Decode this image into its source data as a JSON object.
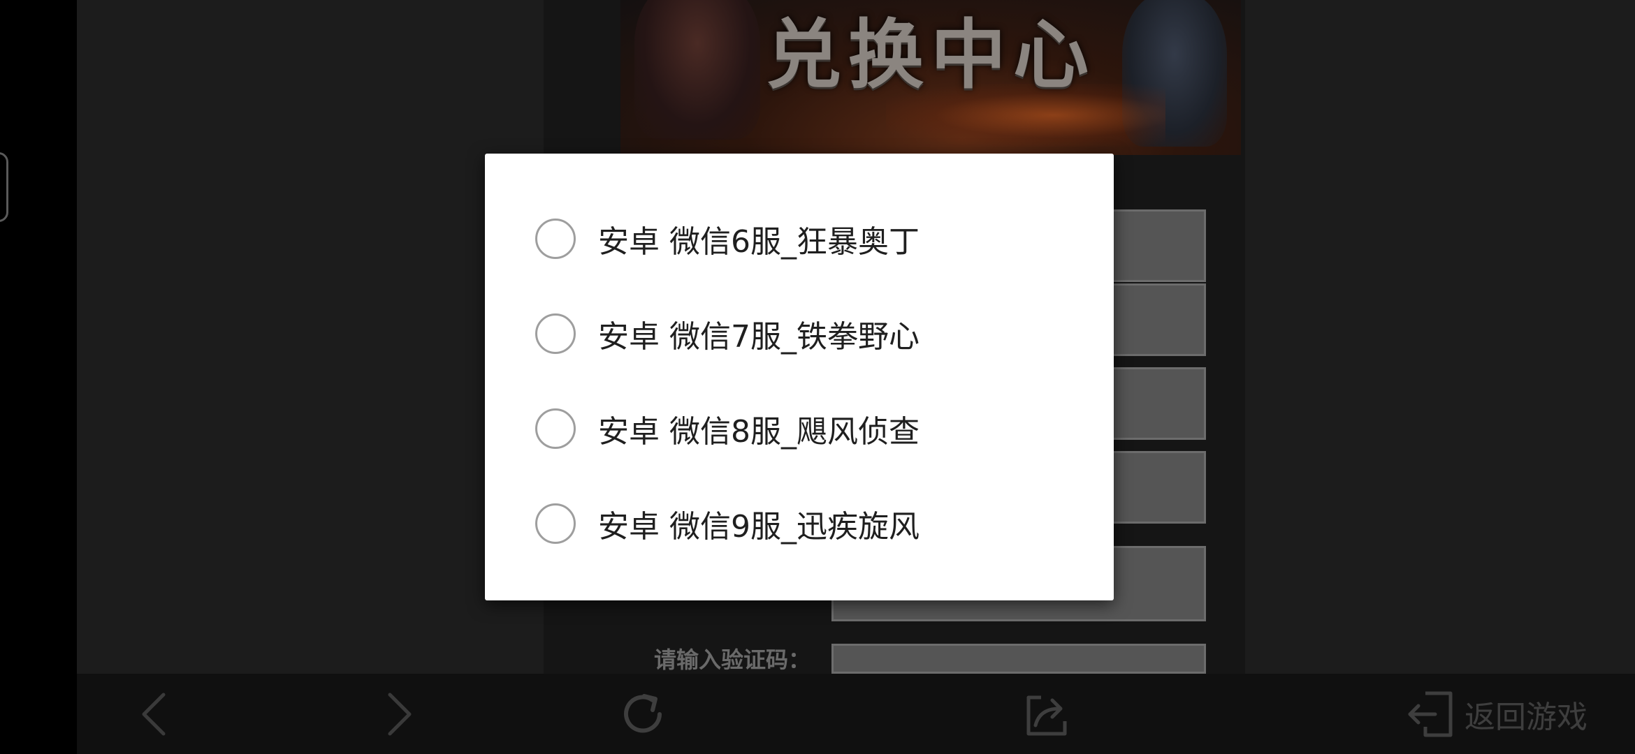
{
  "banner": {
    "title": "兑换中心"
  },
  "form": {
    "captcha_label": "请输入验证码："
  },
  "dialog": {
    "options": [
      {
        "label": "安卓 微信6服_狂暴奥丁",
        "selected": false
      },
      {
        "label": "安卓 微信7服_铁拳野心",
        "selected": false
      },
      {
        "label": "安卓 微信8服_飓风侦查",
        "selected": false
      },
      {
        "label": "安卓 微信9服_迅疾旋风",
        "selected": false
      }
    ]
  },
  "toolbar": {
    "back_icon": "chevron-left-icon",
    "forward_icon": "chevron-right-icon",
    "refresh_icon": "refresh-icon",
    "share_icon": "share-icon",
    "return_icon": "exit-icon",
    "return_label": "返回游戏"
  },
  "colors": {
    "dialog_bg": "#ffffff",
    "radio_border": "#9e9e9e",
    "toolbar_bg": "#101010",
    "toolbar_icon": "#3e3e3e"
  }
}
